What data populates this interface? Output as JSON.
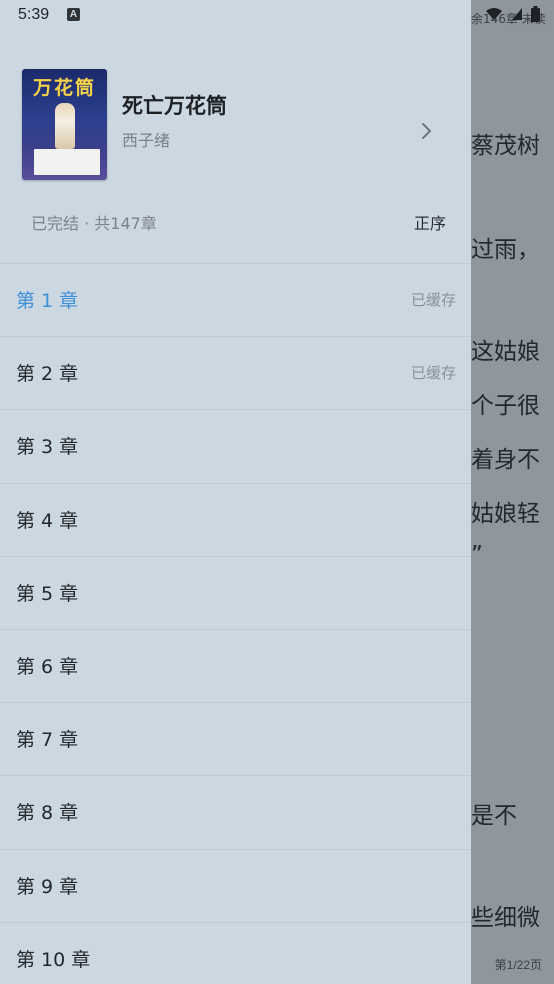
{
  "status_bar": {
    "time": "5:39"
  },
  "book": {
    "title": "死亡万花筒",
    "author": "西子绪",
    "cover_title": "万花筒"
  },
  "meta": {
    "info": "已完结 · 共147章",
    "sort_label": "正序"
  },
  "chapters": [
    {
      "label": "第 1 章",
      "status": "已缓存",
      "active": true
    },
    {
      "label": "第 2 章",
      "status": "已缓存"
    },
    {
      "label": "第 3 章",
      "status": ""
    },
    {
      "label": "第 4 章",
      "status": ""
    },
    {
      "label": "第 5 章",
      "status": ""
    },
    {
      "label": "第 6 章",
      "status": ""
    },
    {
      "label": "第 7 章",
      "status": ""
    },
    {
      "label": "第 8 章",
      "status": ""
    },
    {
      "label": "第 9 章",
      "status": ""
    },
    {
      "label": "第 10 章",
      "status": ""
    }
  ],
  "reader_background": {
    "status_text": "余146章 未读",
    "lines": [
      "蔡茂树",
      "过雨，",
      "这姑娘",
      "个子很",
      "着身不",
      "姑娘轻",
      "”",
      "是不",
      "些细微"
    ],
    "page_indicator": "第1/22页"
  },
  "colors": {
    "drawer_bg": "#cbd7e1",
    "active_chapter": "#3d8fd8",
    "overlay": "#8f979d"
  }
}
